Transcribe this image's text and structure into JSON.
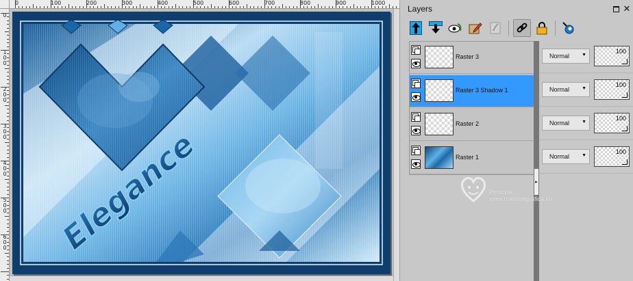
{
  "ruler_top": {
    "labels": [
      {
        "text": "0",
        "pos": 0
      },
      {
        "text": "100",
        "pos": 100
      },
      {
        "text": "200",
        "pos": 200
      },
      {
        "text": "300",
        "pos": 300
      },
      {
        "text": "400",
        "pos": 400
      },
      {
        "text": "500",
        "pos": 500
      },
      {
        "text": "600",
        "pos": 600
      },
      {
        "text": "700",
        "pos": 700
      },
      {
        "text": "800",
        "pos": 800
      },
      {
        "text": "900",
        "pos": 900
      },
      {
        "text": "1000",
        "pos": 1000
      }
    ]
  },
  "ruler_left": {
    "labels": [
      {
        "text": "0",
        "pos": 0
      },
      {
        "text": "100",
        "pos": 100
      },
      {
        "text": "200",
        "pos": 200
      },
      {
        "text": "300",
        "pos": 300
      },
      {
        "text": "400",
        "pos": 400
      },
      {
        "text": "500",
        "pos": 500
      },
      {
        "text": "600",
        "pos": 600
      }
    ]
  },
  "canvas": {
    "artwork_text": "Elegance",
    "colors": {
      "frame": "#0e3e6e",
      "light": "#c9e6f7",
      "mid": "#5aa7dc",
      "deep": "#1a5a96"
    }
  },
  "panel": {
    "title": "Layers",
    "maximize_icon": "maximize-icon",
    "close_glyph": "✕"
  },
  "toolbar": {
    "buttons": [
      {
        "name": "move-layer-up-button",
        "icon": "arrow-up-icon"
      },
      {
        "name": "move-layer-down-button",
        "icon": "arrow-down-icon"
      },
      {
        "name": "toggle-visibility-button",
        "icon": "eye-icon"
      },
      {
        "name": "edit-layer-button",
        "icon": "pencil-icon"
      },
      {
        "name": "mask-button",
        "icon": "mask-icon"
      },
      {
        "name": "link-button",
        "icon": "link-icon"
      },
      {
        "name": "lock-button",
        "icon": "lock-icon"
      },
      {
        "name": "layer-styles-button",
        "icon": "styles-icon"
      }
    ]
  },
  "layers": [
    {
      "name": "Raster 3",
      "blend": "Normal",
      "opacity": "100",
      "selected": false,
      "thumb": "transparent"
    },
    {
      "name": "Raster 3 Shadow 1",
      "blend": "Normal",
      "opacity": "100",
      "selected": true,
      "thumb": "transparent"
    },
    {
      "name": "Raster 2",
      "blend": "Normal",
      "opacity": "100",
      "selected": false,
      "thumb": "transparent"
    },
    {
      "name": "Raster 1",
      "blend": "Normal",
      "opacity": "100",
      "selected": false,
      "thumb": "image"
    }
  ],
  "watermark": {
    "name": "Pinuccia",
    "url": "www.maildiragrafica.eu"
  },
  "splitter": {
    "glyph": "▸"
  }
}
